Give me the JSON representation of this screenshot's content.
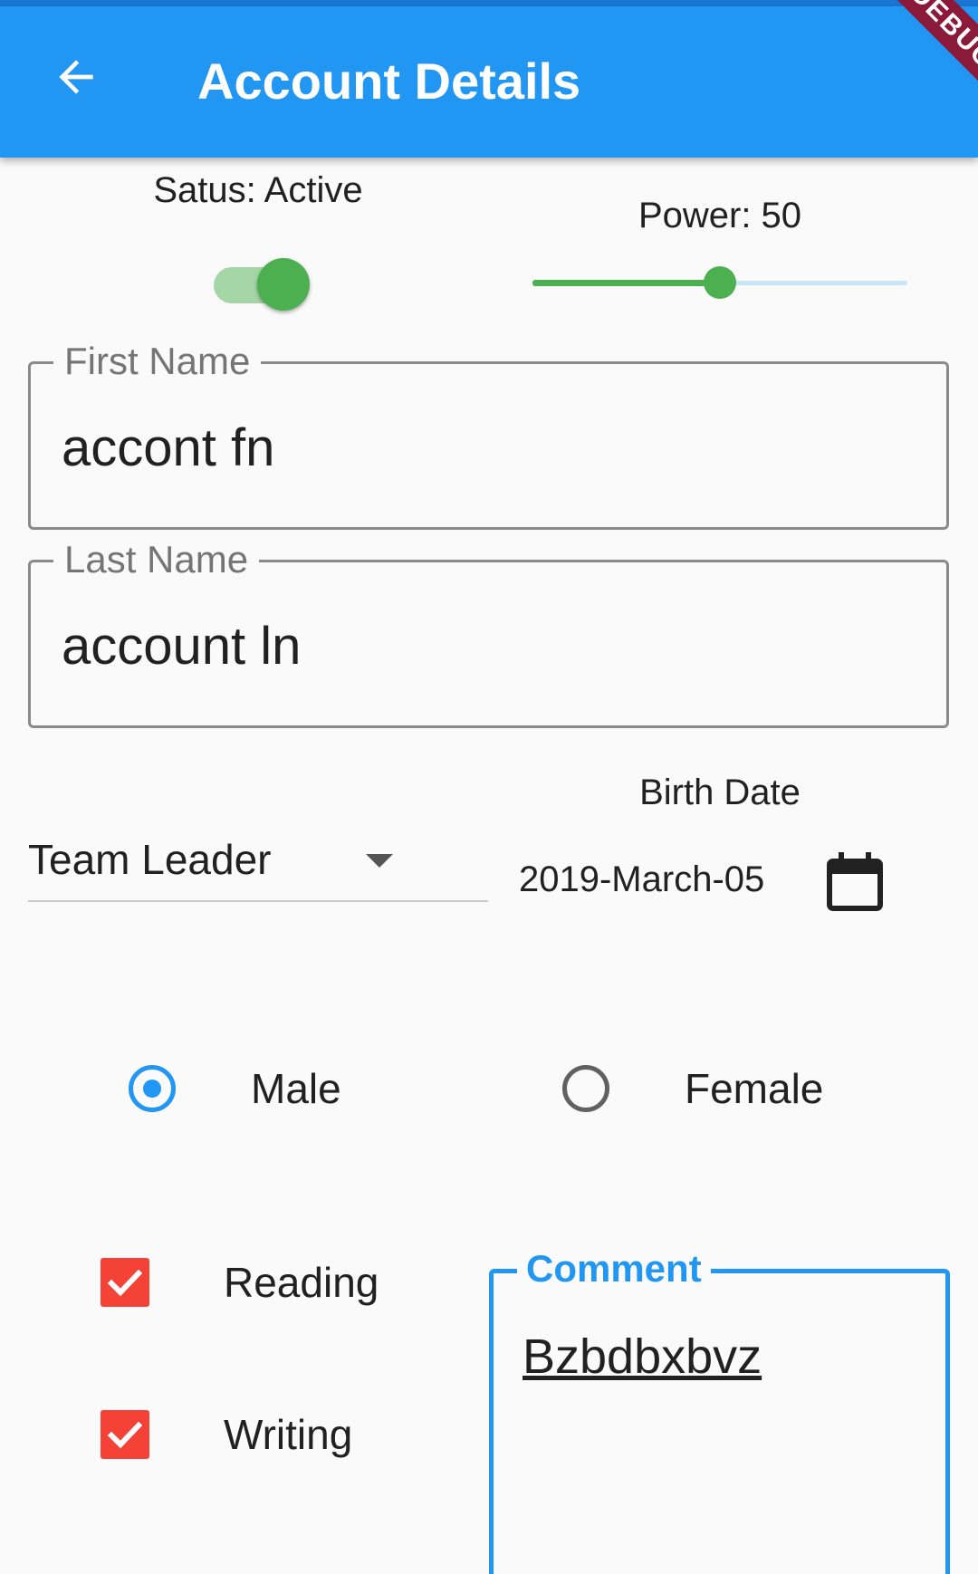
{
  "app_bar": {
    "title": "Account Details",
    "back_icon": "arrow-back-icon",
    "debug_banner": "DEBUG",
    "color": "#2196f3"
  },
  "status": {
    "label": "Satus: Active",
    "switch_on": true,
    "switch_color": "#4caf50"
  },
  "power": {
    "label": "Power: 50",
    "value": 50,
    "max": 100,
    "color": "#4caf50"
  },
  "first_name": {
    "label": "First Name",
    "value": "accont fn"
  },
  "last_name": {
    "label": "Last Name",
    "value": "account ln"
  },
  "role_dropdown": {
    "selected": "Team Leader",
    "icon": "arrow-drop-down-icon"
  },
  "birth_date": {
    "label": "Birth Date",
    "value": "2019-March-05",
    "icon": "calendar-icon"
  },
  "gender": {
    "options": [
      {
        "label": "Male",
        "selected": true
      },
      {
        "label": "Female",
        "selected": false
      }
    ],
    "accent_color": "#2196f3"
  },
  "hobbies": {
    "items": [
      {
        "label": "Reading",
        "checked": true
      },
      {
        "label": "Writing",
        "checked": true
      }
    ],
    "checkbox_color": "#f44336"
  },
  "comment": {
    "label": "Comment",
    "value": "Bzbdbxbvz",
    "focus_color": "#2196f3"
  }
}
